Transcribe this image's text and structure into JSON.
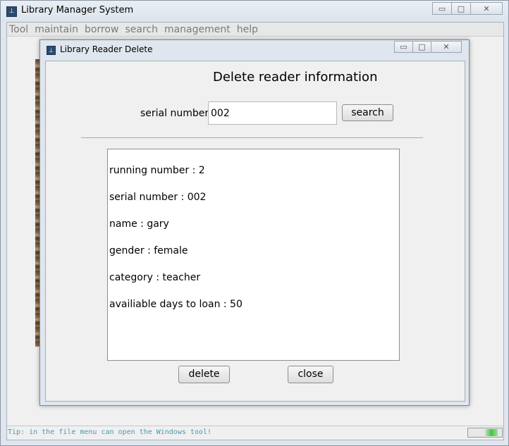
{
  "main_window": {
    "title": "Library Manager System",
    "icon": "app-logo-icon",
    "controls": {
      "minimize": "▭",
      "maximize": "□",
      "close": "✕"
    }
  },
  "menubar": {
    "items": [
      "Tool",
      "maintain",
      "borrow",
      "search",
      "management",
      "help"
    ]
  },
  "statusbar": {
    "tip": "Tip: in the file menu can open the Windows tool!",
    "progress_color": "#3cc83c"
  },
  "dialog": {
    "title": "Library Reader Delete",
    "heading": "Delete reader information",
    "serial_label": "serial number",
    "serial_value": "002",
    "search_label": "search",
    "info_lines": [
      "running number : 2",
      "serial number : 002",
      "name : gary",
      "gender : female",
      "category : teacher",
      "availiable days to loan : 50"
    ],
    "delete_label": "delete",
    "close_label": "close"
  }
}
